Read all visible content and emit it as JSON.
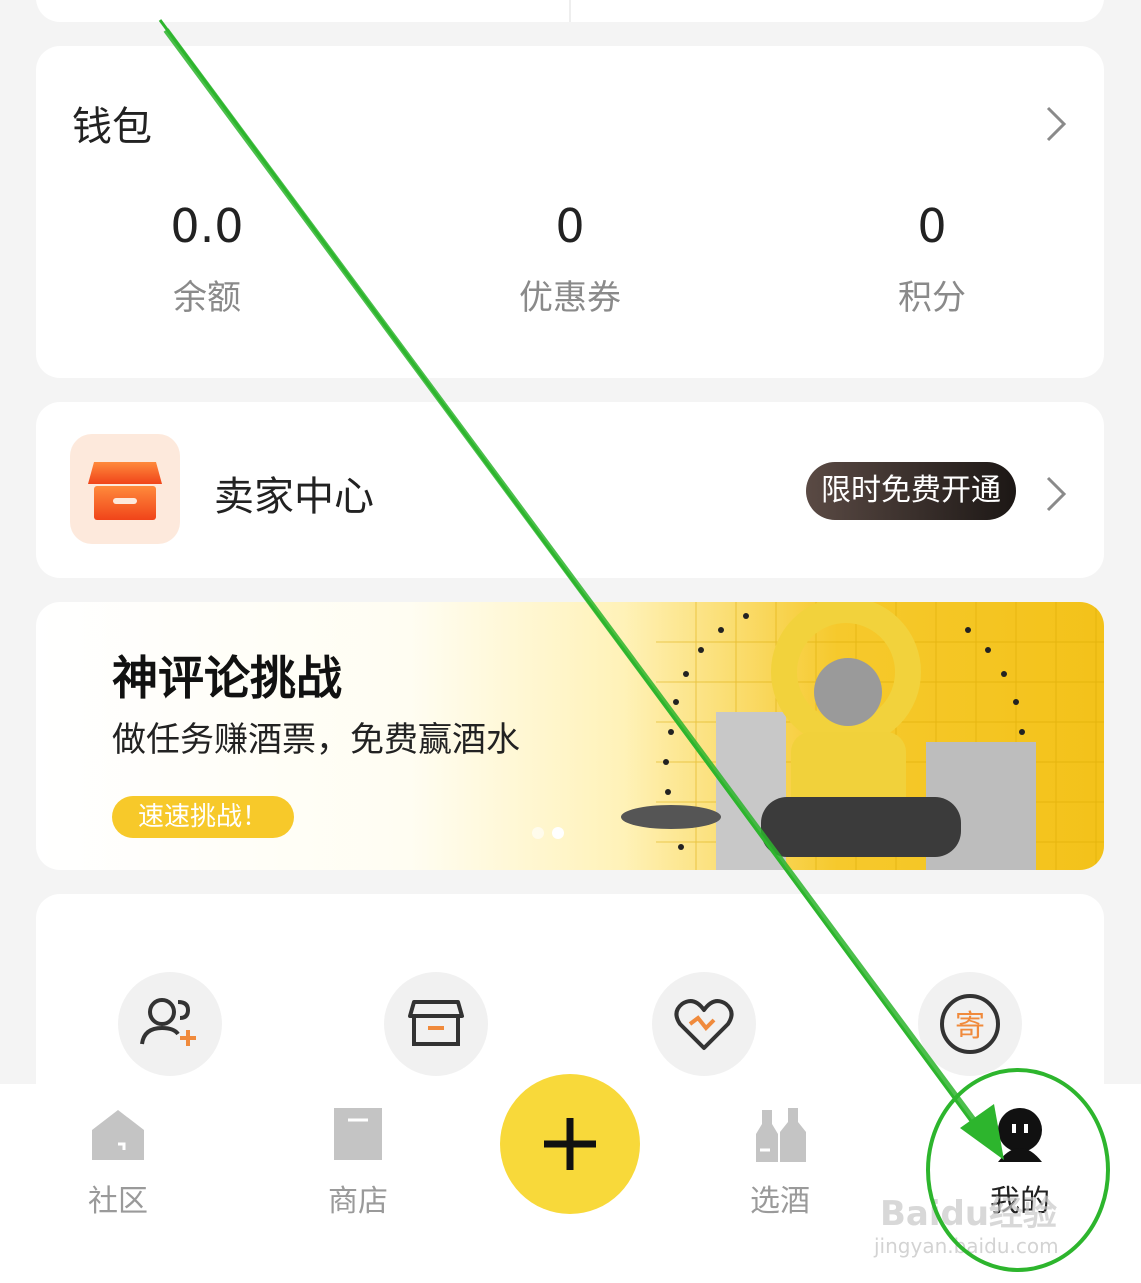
{
  "wallet": {
    "title": "钱包",
    "stats": [
      {
        "value": "0.0",
        "label": "余额"
      },
      {
        "value": "0",
        "label": "优惠券"
      },
      {
        "value": "0",
        "label": "积分"
      }
    ]
  },
  "seller": {
    "title": "卖家中心",
    "badge": "限时免费开通"
  },
  "banner": {
    "title": "神评论挑战",
    "subtitle": "做任务赚酒票，免费赢酒水",
    "button": "速速挑战！"
  },
  "tools": {
    "icons": [
      "user-add-icon",
      "store-icon",
      "heart-icon",
      "mail-ji-icon"
    ],
    "mail_char": "寄"
  },
  "nav": {
    "items": [
      {
        "label": "社区",
        "icon": "house-icon"
      },
      {
        "label": "商店",
        "icon": "shopping-bag-icon"
      },
      {
        "label": "选酒",
        "icon": "bottles-icon"
      },
      {
        "label": "我的",
        "icon": "profile-icon"
      }
    ],
    "active_index": 3
  },
  "watermark": {
    "brand": "Baidu经验",
    "url": "jingyan.baidu.com"
  },
  "colors": {
    "accent_yellow": "#f8d93a",
    "seller_orange": "#f4541c",
    "annotation_green": "#2db52d"
  }
}
